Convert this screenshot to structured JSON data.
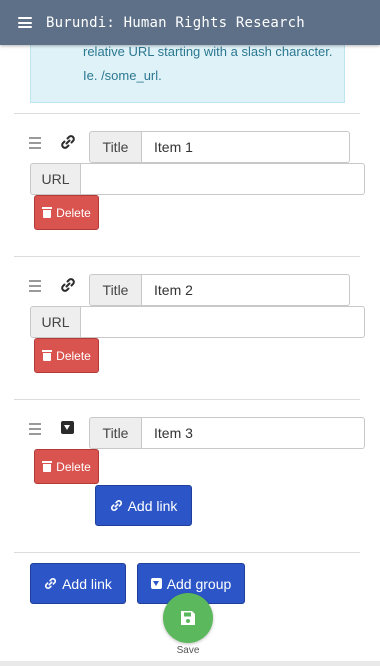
{
  "header": {
    "title": "Burundi: Human Rights Research",
    "menu_icon": "hamburger-icon",
    "bg_color": "#5d7088"
  },
  "info": {
    "text": "relative URL starting with a slash character. Ie. /some_url."
  },
  "items": [
    {
      "icon": "link-icon",
      "title_label": "Title",
      "title_value": "Item 1",
      "url_label": "URL",
      "url_value": "",
      "delete_label": "Delete"
    },
    {
      "icon": "link-icon",
      "title_label": "Title",
      "title_value": "Item 2",
      "url_label": "URL",
      "url_value": "",
      "delete_label": "Delete"
    },
    {
      "icon": "caret-down-icon",
      "title_label": "Title",
      "title_value": "Item 3",
      "delete_label": "Delete",
      "add_link_label": "Add link"
    }
  ],
  "actions": {
    "add_link_label": "Add link",
    "add_group_label": "Add group"
  },
  "save": {
    "label": "Save",
    "icon": "floppy-disk-icon",
    "color": "#5cb85c"
  },
  "colors": {
    "primary": "#2c56c8",
    "danger": "#d9534f",
    "info_bg": "#dff2f8",
    "info_text": "#2c7891"
  }
}
